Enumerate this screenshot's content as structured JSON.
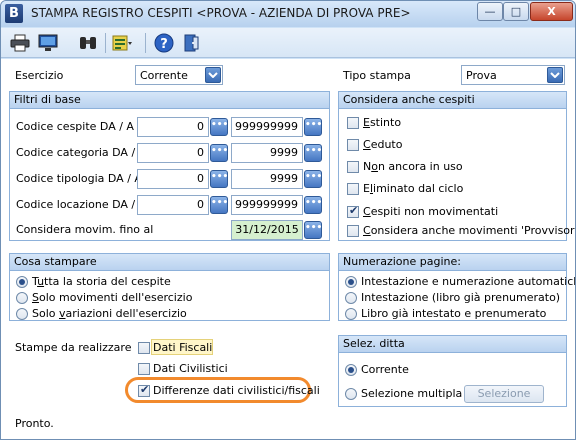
{
  "window": {
    "title": "STAMPA REGISTRO CESPITI <PROVA - AZIENDA DI PROVA PRE>",
    "app_icon_letter": "B",
    "controls": {
      "minimize": "—",
      "maximize": "□",
      "close": "X"
    }
  },
  "toolbar": {
    "icons": [
      "printer-icon",
      "monitor-icon",
      "binoculars-icon",
      "list-options-icon",
      "help-icon",
      "exit-icon"
    ]
  },
  "header": {
    "esercizio_label": "Esercizio",
    "esercizio_value": "Corrente",
    "tipo_stampa_label": "Tipo stampa",
    "tipo_stampa_value": "Prova"
  },
  "filtri": {
    "title": "Filtri di base",
    "rows": [
      {
        "label": "Codice cespite   DA / A",
        "from": "0",
        "to": "999999999"
      },
      {
        "label": "Codice categoria DA / A",
        "from": "0",
        "to": "9999"
      },
      {
        "label": "Codice tipologia  DA / A",
        "from": "0",
        "to": "9999"
      },
      {
        "label": "Codice locazione DA / A",
        "from": "0",
        "to": "999999999"
      }
    ],
    "movim_label": "Considera movim. fino al",
    "movim_date": "31/12/2015"
  },
  "considera": {
    "title": "Considera anche cespiti",
    "options": [
      {
        "pre": "",
        "key": "E",
        "post": "stinto",
        "checked": false
      },
      {
        "pre": "",
        "key": "C",
        "post": "eduto",
        "checked": false
      },
      {
        "pre": "N",
        "key": "o",
        "post": "n ancora in uso",
        "checked": false
      },
      {
        "pre": "E",
        "key": "l",
        "post": "iminato dal ciclo",
        "checked": false
      },
      {
        "pre": "",
        "key": "C",
        "post": "espiti non movimentati",
        "checked": true
      },
      {
        "pre": "",
        "key": "C",
        "post": "onsidera anche movimenti 'Provvisori'",
        "checked": false
      }
    ]
  },
  "cosa": {
    "title": "Cosa stampare",
    "options": [
      {
        "pre": "T",
        "key": "u",
        "post": "tta la storia del cespite",
        "checked": true
      },
      {
        "pre": "",
        "key": "S",
        "post": "olo movimenti dell'esercizio",
        "checked": false
      },
      {
        "pre": "Solo ",
        "key": "v",
        "post": "ariazioni dell'esercizio",
        "checked": false
      }
    ]
  },
  "numerazione": {
    "title": "Numerazione pagine:",
    "options": [
      {
        "label": "Intestazione e numerazione automatiche",
        "checked": true
      },
      {
        "label": "Intestazione (libro già prenumerato)",
        "checked": false
      },
      {
        "label": "Libro già intestato e prenumerato",
        "checked": false
      }
    ]
  },
  "stampe": {
    "label": "Stampe da realizzare",
    "options": [
      {
        "label": "Dati Fiscali",
        "checked": false
      },
      {
        "label": "Dati Civilistici",
        "checked": false
      },
      {
        "label": "Differenze dati civilistici/fiscali",
        "checked": true
      }
    ]
  },
  "ditta": {
    "title": "Selez. ditta",
    "corrente": "Corrente",
    "multipla": "Selezione multipla",
    "button": "Selezione"
  },
  "status": "Pronto.",
  "colors": {
    "highlight": "#f28a2d",
    "group_header": "#c7dcf3",
    "date_field": "#d6f0cf"
  }
}
